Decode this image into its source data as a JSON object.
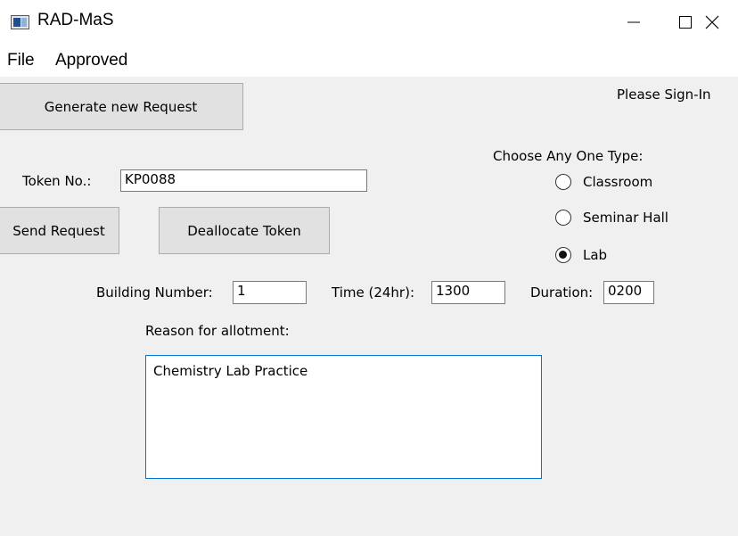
{
  "window": {
    "title": "RAD-MaS",
    "minimize_glyph": "—",
    "maximize_glyph": "☐",
    "close_glyph": "✕"
  },
  "menu": {
    "items": [
      "File",
      "Approved"
    ]
  },
  "header": {
    "generate_button": "Generate new Request",
    "signin_status": "Please Sign-In"
  },
  "token": {
    "label": "Token No.:",
    "value": "KP0088"
  },
  "actions": {
    "send_button": "Send Request",
    "deallocate_button": "Deallocate Token"
  },
  "type_selector": {
    "heading": "Choose Any One Type:",
    "options": [
      {
        "label": "Classroom",
        "checked": false
      },
      {
        "label": "Seminar Hall",
        "checked": false
      },
      {
        "label": "Lab",
        "checked": true
      }
    ]
  },
  "details": {
    "building_label": "Building Number:",
    "building_value": "1",
    "time_label": "Time (24hr):",
    "time_value": "1300",
    "duration_label": "Duration:",
    "duration_value": "0200"
  },
  "reason": {
    "label": "Reason for allotment:",
    "value": "Chemistry Lab Practice"
  }
}
